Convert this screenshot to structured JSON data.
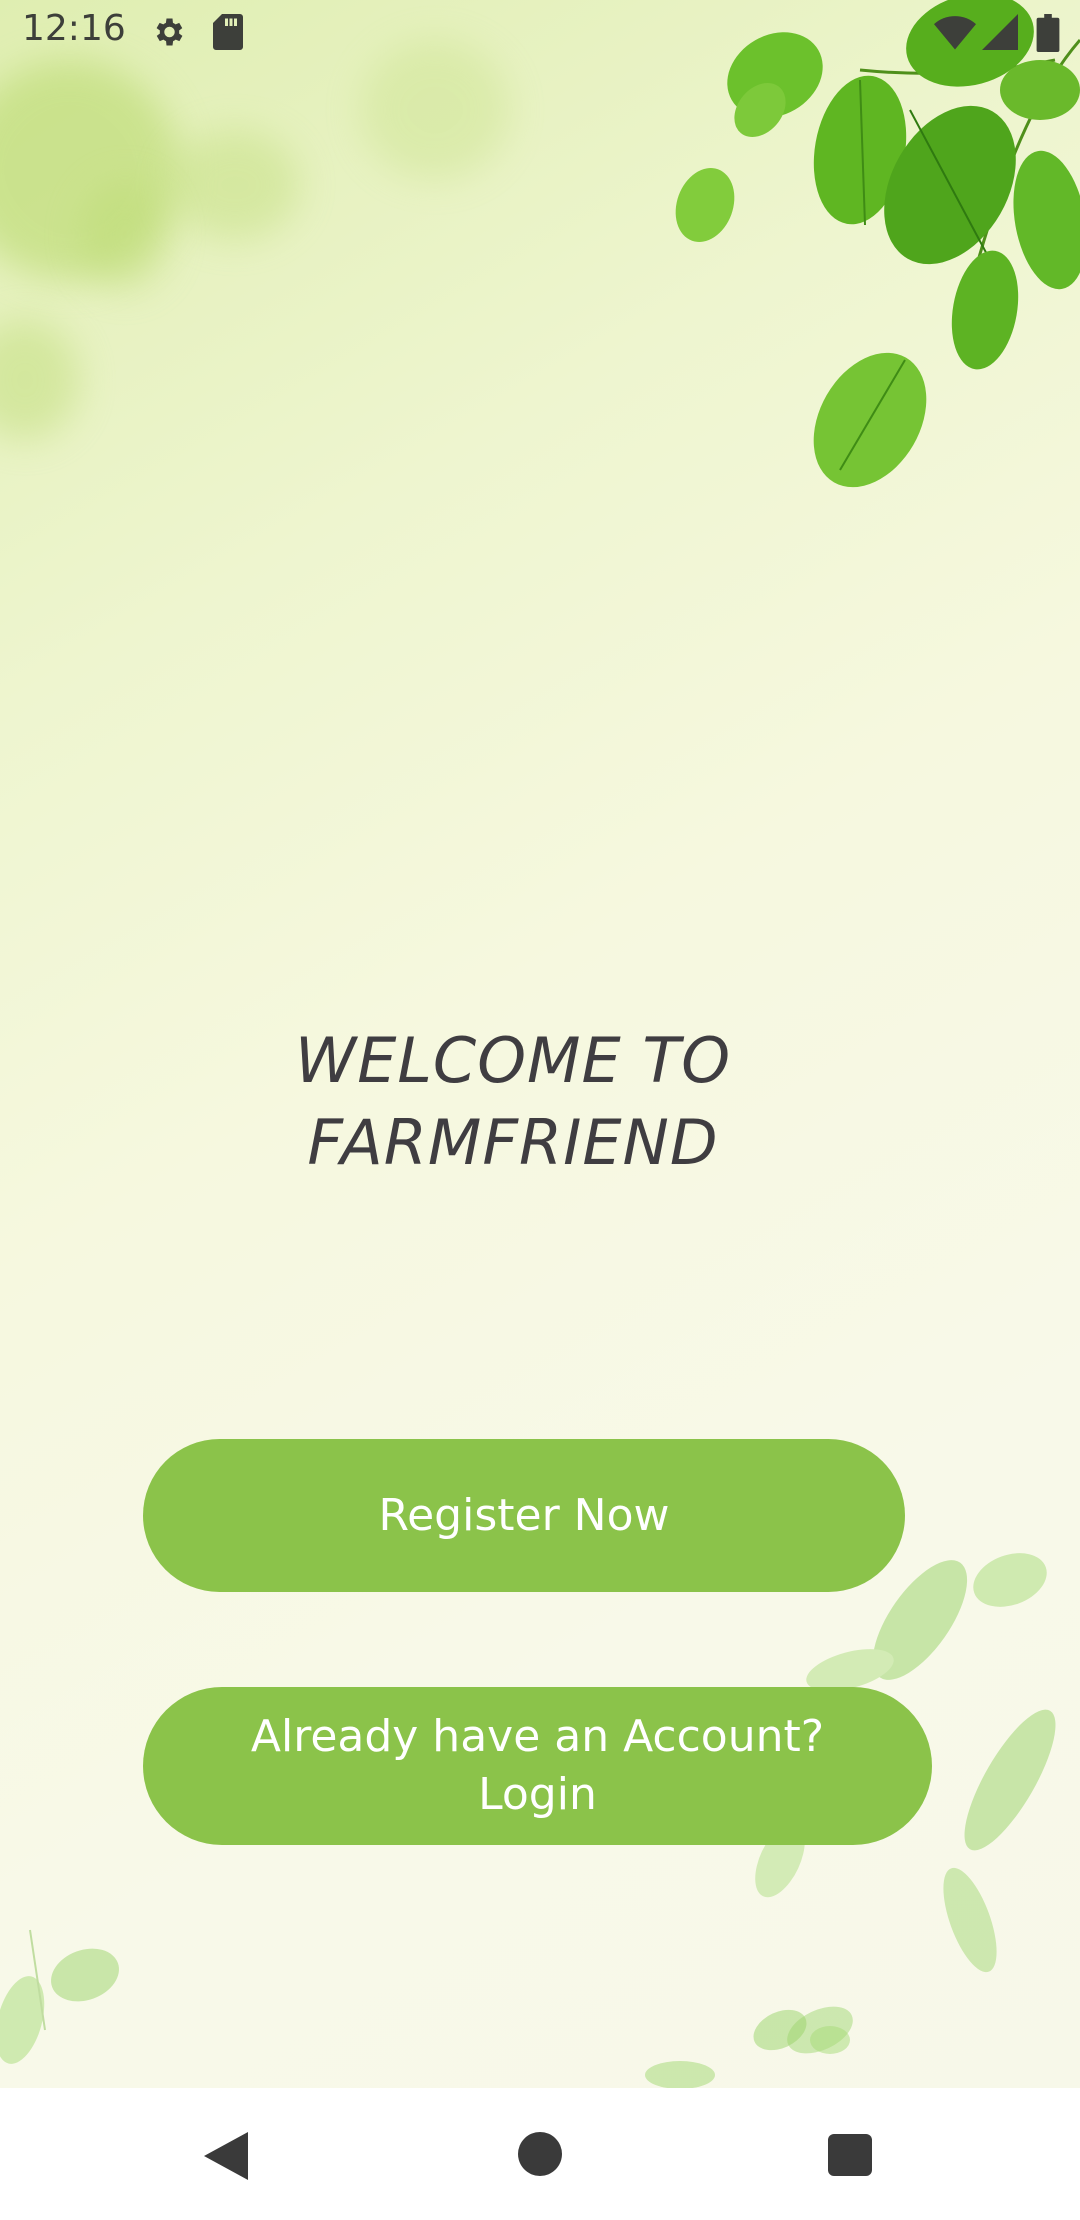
{
  "status_bar": {
    "time": "12:16",
    "icons": [
      "settings-icon",
      "sd-card-icon",
      "wifi-icon",
      "cell-signal-icon",
      "battery-icon"
    ]
  },
  "welcome": {
    "line1": "WELCOME TO",
    "line2": "FARMFRIEND"
  },
  "buttons": {
    "register_label": "Register Now",
    "login_line1": "Already have an Account?",
    "login_line2": "Login"
  },
  "nav_bar": {
    "icons": [
      "back-icon",
      "home-icon",
      "recents-icon"
    ]
  },
  "colors": {
    "button": "#8bc34a",
    "button_text": "#ffffff",
    "title_text": "#3f3d41",
    "leaf_green": "#7cc62a"
  }
}
